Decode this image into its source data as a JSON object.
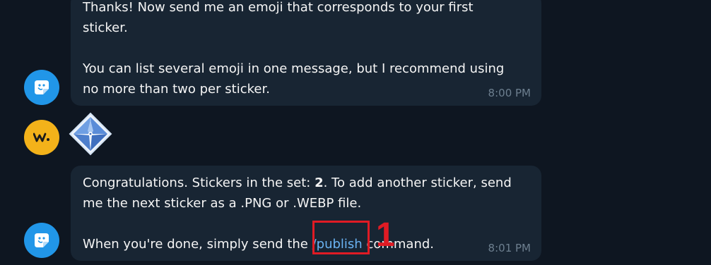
{
  "messages": [
    {
      "sender": "bot",
      "line1": "Thanks! Now send me an emoji that corresponds to your first",
      "line2": "sticker.",
      "line3": "You can list several emoji in one message, but I recommend using",
      "line4": "no more than two per sticker.",
      "time": "8:00 PM"
    },
    {
      "sender": "user",
      "sticker_icon": "blue-diamond-tile-sticker"
    },
    {
      "sender": "bot",
      "line1_prefix": "Congratulations. Stickers in the set: ",
      "line1_count": "2",
      "line1_suffix": ". To add another sticker, send",
      "line2": "me the next sticker as a .PNG or .WEBP file.",
      "line3_prefix": "When you're done, simply send the ",
      "command": "/publish",
      "line3_suffix": " command.",
      "time": "8:01 PM"
    }
  ],
  "annotation": {
    "label": "1",
    "color": "#e01b24"
  },
  "colors": {
    "background": "#0e1621",
    "bubble": "#182533",
    "link": "#6ab3f3",
    "bot_avatar": "#2196e8",
    "user_avatar": "#f3b21a"
  }
}
